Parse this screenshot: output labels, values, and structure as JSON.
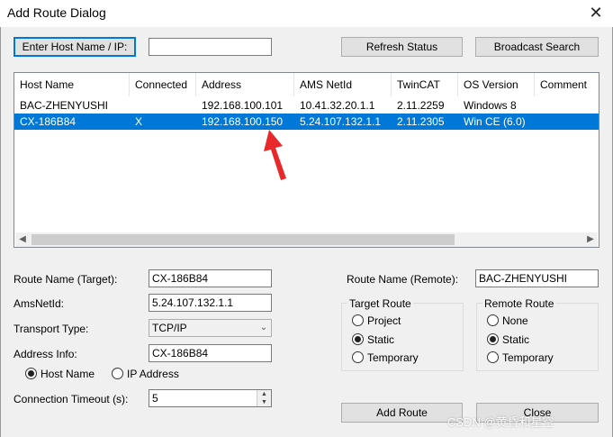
{
  "window": {
    "title": "Add Route Dialog",
    "close_glyph": "✕"
  },
  "toolbar": {
    "enter_host_label": "Enter Host Name / IP:",
    "host_input_value": "",
    "refresh_label": "Refresh Status",
    "broadcast_label": "Broadcast Search"
  },
  "table": {
    "columns": [
      "Host Name",
      "Connected",
      "Address",
      "AMS NetId",
      "TwinCAT",
      "OS Version",
      "Comment"
    ],
    "rows": [
      {
        "host": "BAC-ZHENYUSHI",
        "connected": "",
        "address": "192.168.100.101",
        "netid": "10.41.32.20.1.1",
        "twincat": "2.11.2259",
        "os": "Windows 8",
        "comment": ""
      },
      {
        "host": "CX-186B84",
        "connected": "X",
        "address": "192.168.100.150",
        "netid": "5.24.107.132.1.1",
        "twincat": "2.11.2305",
        "os": "Win CE (6.0)",
        "comment": ""
      }
    ],
    "selected_row": 1
  },
  "form": {
    "route_name_target_label": "Route Name (Target):",
    "route_name_target_value": "CX-186B84",
    "amsnetid_label": "AmsNetId:",
    "amsnetid_value": "5.24.107.132.1.1",
    "transport_label": "Transport Type:",
    "transport_value": "TCP/IP",
    "address_info_label": "Address Info:",
    "address_info_value": "CX-186B84",
    "host_name_radio": "Host Name",
    "ip_address_radio": "IP Address",
    "timeout_label": "Connection Timeout (s):",
    "timeout_value": "5",
    "route_name_remote_label": "Route Name (Remote):",
    "route_name_remote_value": "BAC-ZHENYUSHI"
  },
  "target_route": {
    "title": "Target Route",
    "project": "Project",
    "static": "Static",
    "temporary": "Temporary",
    "selected": "static"
  },
  "remote_route": {
    "title": "Remote Route",
    "none": "None",
    "static": "Static",
    "temporary": "Temporary",
    "selected": "static"
  },
  "buttons": {
    "add_route": "Add Route",
    "close": "Close"
  },
  "watermark": "CSDN @黄昏和星空",
  "colors": {
    "selection": "#0078d7",
    "annotation_arrow": "#e8282b",
    "focus_border": "#0078d7"
  }
}
